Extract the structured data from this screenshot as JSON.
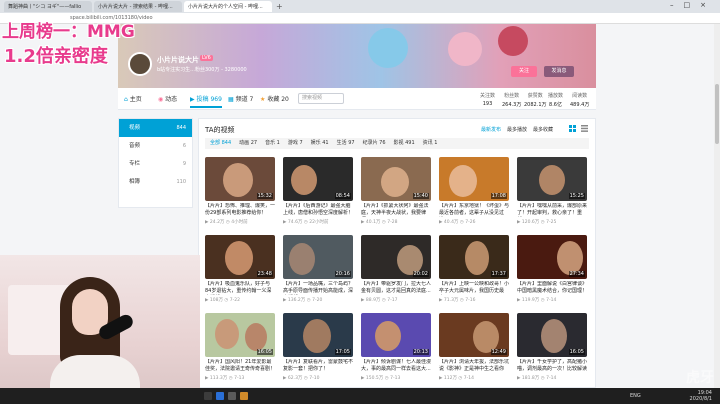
{
  "browser": {
    "tabs": [
      {
        "label": "舞蹈神曲丨\"シコ ヨギ\"——fallio"
      },
      {
        "label": "小片片说大片 - 搜索结果 - 哔哩..."
      },
      {
        "label": "小片片说大片的个人空间 - 哔哩..."
      }
    ],
    "address": "space.bilibili.com/1013180/video"
  },
  "overlay": {
    "title": "上周榜一：MMG",
    "subtitle": "1.2倍亲密度"
  },
  "profile": {
    "name": "小片片说大片",
    "level": "LV6",
    "signature": "b站专注实习生...粉丝300万 - 3280000",
    "follow_label": "关注",
    "message_label": "发消息"
  },
  "nav": {
    "items": [
      {
        "label": "主页",
        "icon": "home-icon"
      },
      {
        "label": "动态",
        "icon": "activity-icon"
      },
      {
        "label": "投稿 969",
        "icon": "video-icon"
      },
      {
        "label": "频道 7",
        "icon": "channel-icon"
      },
      {
        "label": "收藏 20",
        "icon": "star-icon"
      }
    ],
    "search_placeholder": "搜索视频",
    "stats": [
      {
        "label": "关注数",
        "value": "193"
      },
      {
        "label": "粉丝数",
        "value": "264.3万"
      },
      {
        "label": "获赞数",
        "value": "2082.1万"
      },
      {
        "label": "播放数",
        "value": "8.6亿"
      },
      {
        "label": "阅读数",
        "value": "489.4万"
      }
    ]
  },
  "sidebar": {
    "items": [
      {
        "label": "视频",
        "count": "844"
      },
      {
        "label": "音频",
        "count": "6"
      },
      {
        "label": "专栏",
        "count": "9"
      },
      {
        "label": "相簿",
        "count": "110"
      }
    ]
  },
  "main": {
    "title": "TA的视频",
    "sorts": [
      "最新发布",
      "最多播放",
      "最多收藏"
    ],
    "filters": [
      "全部 844",
      "动画 27",
      "音乐 1",
      "游戏 7",
      "娱乐 41",
      "生活 97",
      "纪录片 76",
      "影视 491",
      "资讯 1"
    ],
    "videos": [
      {
        "title": "【片片】恐怖、推理、爆笑，一份29部系列电影推荐给你！",
        "plays": "24.2万",
        "date": "4小时前",
        "duration": "15:32"
      },
      {
        "title": "【片片】《后西游记》最强大脑上线，唐僧和孙悟空深度解析！",
        "plays": "74.6万",
        "date": "22小时前",
        "duration": "08:54"
      },
      {
        "title": "【片片】《抓紧大状阿》最强法庭，天神半夜大战状，我要律师...",
        "plays": "40.1万",
        "date": "7-28",
        "duration": "15:40"
      },
      {
        "title": "【片片】东京地狱！《坏蛋》与最近各前者，这辈子从没见过谁...",
        "plays": "40.4万",
        "date": "7-26",
        "duration": "17:08"
      },
      {
        "title": "【片片】嘿嘿从前采，爆部原来了！开起审判，救心亲了！重新...",
        "plays": "120.6万",
        "date": "7-25",
        "duration": "15:25"
      },
      {
        "title": "【片片】吸血鬼乐队，好子与84岁退钻大，重传约翰一义深度解析！",
        "plays": "108万",
        "date": "7-22",
        "duration": "23:48"
      },
      {
        "title": "【片片】一场品嘴，三个岛屿？高手原导面传播开始高能成，深度解析",
        "plays": "136.2万",
        "date": "7-20",
        "duration": "20:16"
      },
      {
        "title": "【片片】带驱罗发门，拉大七人金有贝圆，这才是回真的法庭...",
        "plays": "88.9万",
        "date": "7-17",
        "duration": "20:02"
      },
      {
        "title": "【片片】上映一公映和政哥！小卒子大元属味片，我国历史最大...",
        "plays": "71.3万",
        "date": "7-16",
        "duration": "17:37"
      },
      {
        "title": "【片片】里面解说《白宫律谈》中国暗黑魔术结合，你记国理！",
        "plays": "119.9万",
        "date": "7-14",
        "duration": "27:34"
      },
      {
        "title": "【片片】国风阳！21年爱影最佳奖，法院邀请王奇传奇喜剧！",
        "plays": "113.3万",
        "date": "7-13",
        "duration": "16:05"
      },
      {
        "title": "【片片】复联看片，雷蒙鼓宅不复影一套！把你了！",
        "plays": "62.3万",
        "date": "7-10",
        "duration": "17:05"
      },
      {
        "title": "【片片】倾诉剧谋！七人最佳漫大，事的最高同一样去看这大...",
        "plays": "150.5万",
        "date": "7-13",
        "duration": "20:13"
      },
      {
        "title": "【片片】浏请大年拔，法部乐坑说《影神》正是神中生之看你",
        "plays": "112万",
        "date": "7-14",
        "duration": "12:49"
      },
      {
        "title": "【片片】千女学护了，高配猪小喵，调剂最高的一次！比较解读",
        "plays": "181.8万",
        "date": "7-14",
        "duration": "16:05"
      }
    ]
  },
  "taskbar": {
    "lang": "ENG",
    "time": "19:04",
    "date": "2020/8/1"
  },
  "watermark": "虎牙"
}
